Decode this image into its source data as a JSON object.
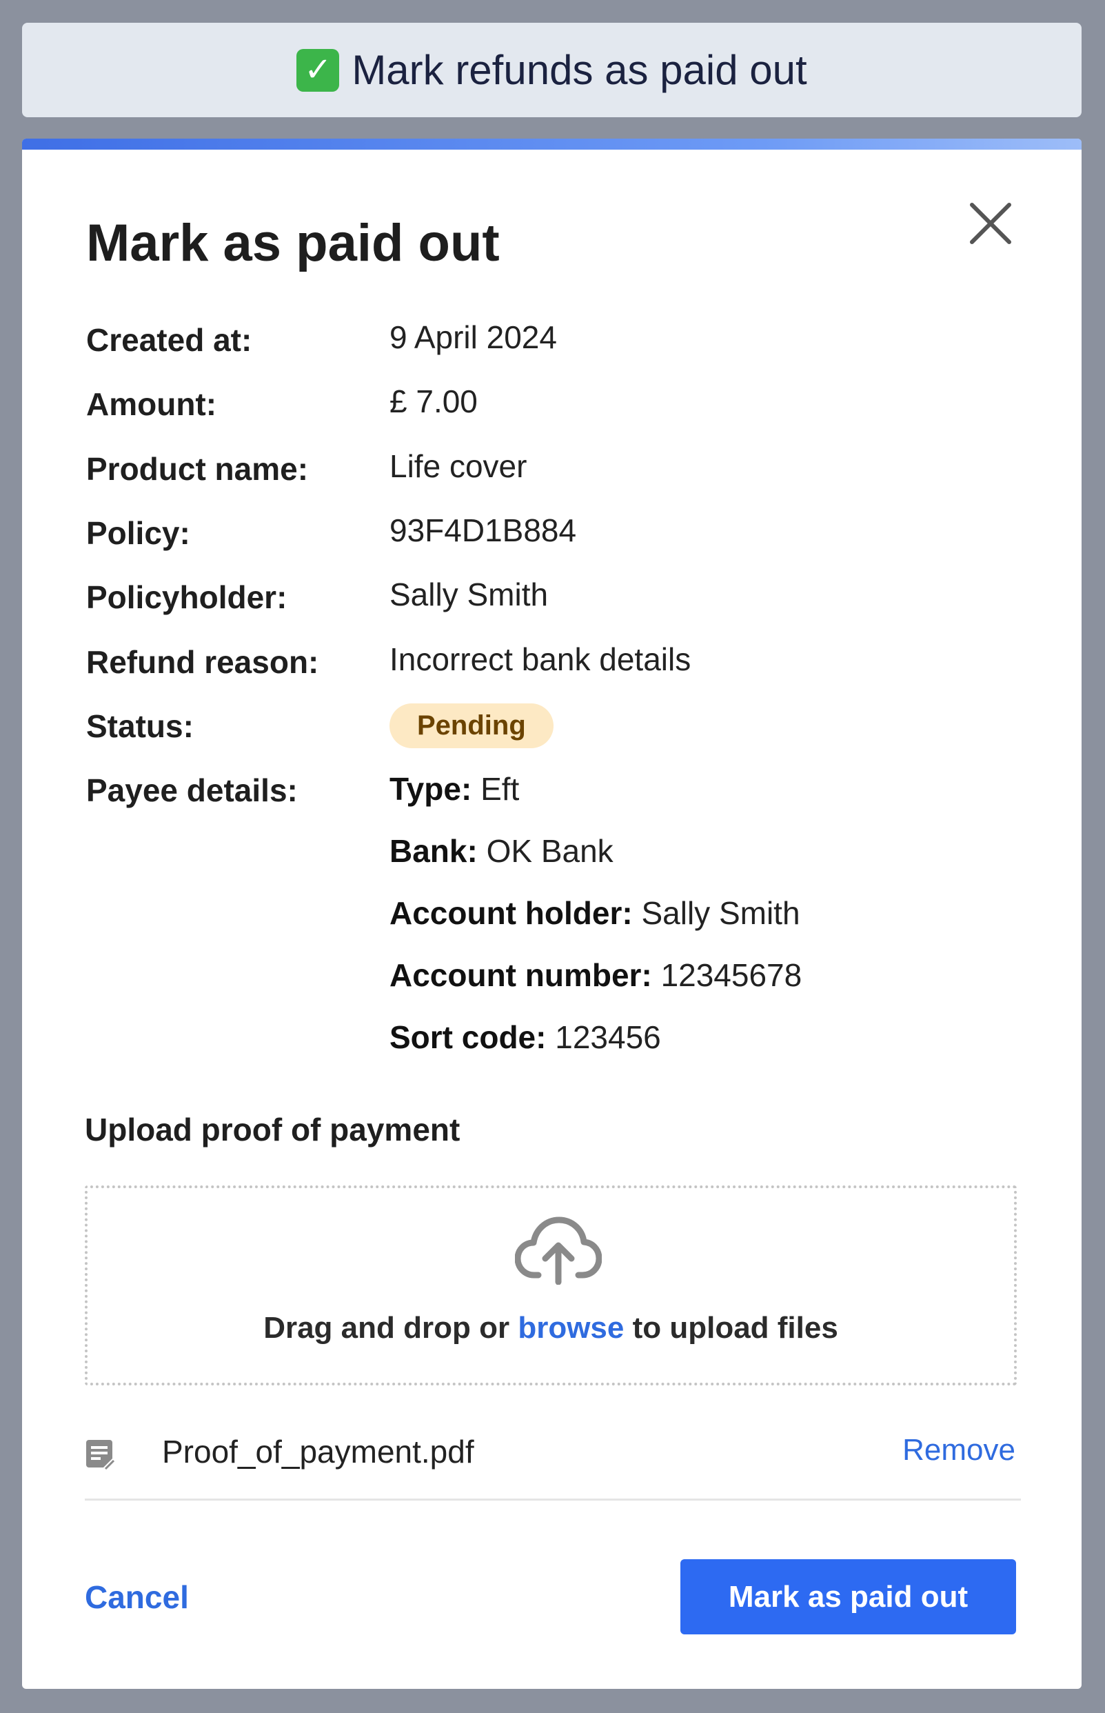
{
  "banner": {
    "icon": "check-mark-icon",
    "text": "Mark refunds as paid out"
  },
  "modal": {
    "title": "Mark as paid out",
    "close_icon": "close-icon",
    "fields": {
      "created_at": {
        "label": "Created at:",
        "value": "9 April 2024"
      },
      "amount": {
        "label": "Amount:",
        "value": "£ 7.00"
      },
      "product_name": {
        "label": "Product name:",
        "value": "Life cover"
      },
      "policy": {
        "label": "Policy:",
        "value": "93F4D1B884"
      },
      "policyholder": {
        "label": "Policyholder:",
        "value": "Sally Smith"
      },
      "refund_reason": {
        "label": "Refund reason:",
        "value": "Incorrect bank details"
      },
      "status": {
        "label": "Status:",
        "value": "Pending"
      },
      "payee_details": {
        "label": "Payee details:"
      }
    },
    "payee": {
      "type_label": "Type:",
      "type_value": "Eft",
      "bank_label": "Bank:",
      "bank_value": "OK Bank",
      "holder_label": "Account holder:",
      "holder_value": "Sally Smith",
      "account_label": "Account number:",
      "account_value": "12345678",
      "sort_label": "Sort code:",
      "sort_value": "123456"
    },
    "upload": {
      "title": "Upload proof of payment",
      "icon": "cloud-upload-icon",
      "text_before": "Drag and drop or ",
      "browse_link": "browse",
      "text_after": " to upload files"
    },
    "file": {
      "icon": "document-icon",
      "name": "Proof_of_payment.pdf",
      "remove_label": "Remove"
    },
    "actions": {
      "cancel_label": "Cancel",
      "submit_label": "Mark as paid out"
    }
  },
  "colors": {
    "background": "#8b919e",
    "banner_bg": "#e3e8ef",
    "link": "#2f6bdf",
    "primary_button": "#2d6af2",
    "badge_bg": "#fde9c4",
    "badge_text": "#6b4300"
  }
}
